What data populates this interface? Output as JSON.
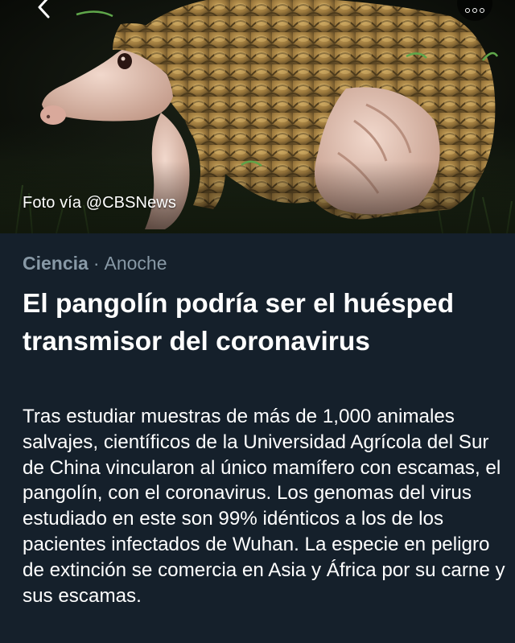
{
  "hero": {
    "photo_credit": "Foto vía @CBSNews",
    "back_icon": "chevron-left-icon",
    "more_icon": "more-options-icon"
  },
  "article": {
    "category": "Ciencia",
    "separator": "·",
    "time": "Anoche",
    "headline": "El pangolín podría ser el huésped transmisor del coronavirus",
    "summary": "Tras estudiar muestras de más de 1,000 animales salvajes, científicos de la Universidad Agrícola del Sur de China vincularon al único mamífero con escamas, el pangolín, con el coronavirus. Los genomas del virus estudiado en este son 99% idénticos a los de los pacientes infectados de Wuhan. La especie en peligro de extinción se comercia en Asia y África por su carne y sus escamas."
  },
  "colors": {
    "background": "#15202b",
    "meta_text": "#8899a6",
    "headline_text": "#ffffff",
    "body_text": "#ffffff"
  }
}
